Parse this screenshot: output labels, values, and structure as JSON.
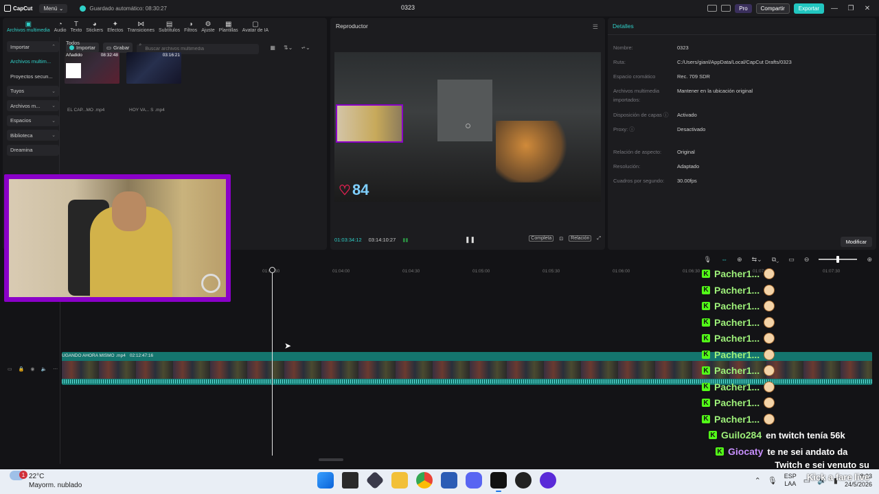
{
  "titlebar": {
    "app_name": "CapCut",
    "menu": "Menú",
    "autosave": "Guardado automático: 08:30:27",
    "project": "0323",
    "pro": "Pro",
    "share": "Compartir",
    "export": "Exportar"
  },
  "tools": [
    {
      "label": "Archivos multimedia",
      "icon": "media-icon",
      "glyph": "▣"
    },
    {
      "label": "Audio",
      "icon": "audio-icon",
      "glyph": "◔"
    },
    {
      "label": "Texto",
      "icon": "text-icon",
      "glyph": "T"
    },
    {
      "label": "Stickers",
      "icon": "sticker-icon",
      "glyph": "◕"
    },
    {
      "label": "Efectos",
      "icon": "effects-icon",
      "glyph": "✦"
    },
    {
      "label": "Transiciones",
      "icon": "transitions-icon",
      "glyph": "⋈"
    },
    {
      "label": "Subtítulos",
      "icon": "subtitles-icon",
      "glyph": "▤"
    },
    {
      "label": "Filtros",
      "icon": "filters-icon",
      "glyph": "◑"
    },
    {
      "label": "Ajuste",
      "icon": "adjust-icon",
      "glyph": "⚙"
    },
    {
      "label": "Plantillas",
      "icon": "templates-icon",
      "glyph": "▦"
    },
    {
      "label": "Avatar de IA",
      "icon": "ai-avatar-icon",
      "glyph": "▢"
    }
  ],
  "sidebar": {
    "items": [
      {
        "label": "Importar",
        "chev": "⌃"
      },
      {
        "label": "Archivos multim...",
        "chev": ""
      },
      {
        "label": "Proyectos secun...",
        "chev": ""
      },
      {
        "label": "Tuyos",
        "chev": "⌄"
      },
      {
        "label": "Archivos m...",
        "chev": "⌄"
      },
      {
        "label": "Espacios",
        "chev": "⌄"
      },
      {
        "label": "Biblioteca",
        "chev": "⌄"
      },
      {
        "label": "Dreamina",
        "chev": ""
      }
    ]
  },
  "media": {
    "import": "Importar",
    "record": "Grabar",
    "search_placeholder": "Buscar archivos multimedia",
    "section": "Todos",
    "clips": [
      {
        "tag": "Añadido",
        "duration": "08:32:48",
        "name": "EL CAP...MO .mp4"
      },
      {
        "tag": "",
        "duration": "03:16:21",
        "name": "HOY VA... S .mp4"
      }
    ]
  },
  "player": {
    "title": "Reproductor",
    "current": "01:03:34:12",
    "total": "03:14:10:27",
    "full": "Completa",
    "ratio": "Relación",
    "hearts": "84"
  },
  "details": {
    "title": "Detalles",
    "rows": [
      {
        "k": "Nombre:",
        "v": "0323"
      },
      {
        "k": "Ruta:",
        "v": "C:/Users/gianl/AppData/Local/CapCut Drafts/0323"
      },
      {
        "k": "Espacio cromático",
        "v": "Rec. 709 SDR"
      },
      {
        "k": "Archivos multimedia importados:",
        "v": "Mantener en la ubicación original"
      },
      {
        "k": "Disposición de capas ⓘ",
        "v": "Activado"
      },
      {
        "k": "Proxy: ⓘ",
        "v": "Desactivado"
      },
      {
        "k": "Relación de aspecto:",
        "v": "Original"
      },
      {
        "k": "Resolución:",
        "v": "Adaptado"
      },
      {
        "k": "Cuadros por segundo:",
        "v": "30.00fps"
      }
    ],
    "modify": "Modificar"
  },
  "timeline": {
    "ruler": [
      "01:03:30",
      "01:04:00",
      "01:04:30",
      "01:05:00",
      "01:05:30",
      "01:06:00",
      "01:06:30",
      "01:07:00",
      "01:07:30"
    ],
    "clip_name": "UGANDO AHORA MISMO .mp4",
    "clip_duration": "02:12:47:16",
    "zoom_level": 0.5
  },
  "chat": {
    "messages": [
      {
        "user": "Pacher1...",
        "text": ""
      },
      {
        "user": "Pacher1...",
        "text": ""
      },
      {
        "user": "Pacher1...",
        "text": ""
      },
      {
        "user": "Pacher1...",
        "text": ""
      },
      {
        "user": "Pacher1...",
        "text": ""
      },
      {
        "user": "Pacher1...",
        "text": ""
      },
      {
        "user": "Pacher1...",
        "text": ""
      },
      {
        "user": "Pacher1...",
        "text": ""
      },
      {
        "user": "Pacher1...",
        "text": ""
      },
      {
        "user": "Pacher1...",
        "text": ""
      },
      {
        "user": "Guilo284",
        "text": "en twitch tenía 56k"
      },
      {
        "user": "Giocaty",
        "text": "te ne sei andato da"
      }
    ],
    "overlay_lines": [
      "Twitch e sei venuto su",
      "Kick a fare live"
    ]
  },
  "taskbar": {
    "badge": "1",
    "temp": "22°C",
    "weather": "Mayorm. nublado",
    "lang1": "ESP",
    "lang2": "LAA",
    "time": "8:33",
    "date": "24/5/2026"
  },
  "colors": {
    "accent": "#2fd0c8",
    "cam_frame": "#8a00c8",
    "kick_green": "#53fc18",
    "clip": "#14756e"
  }
}
